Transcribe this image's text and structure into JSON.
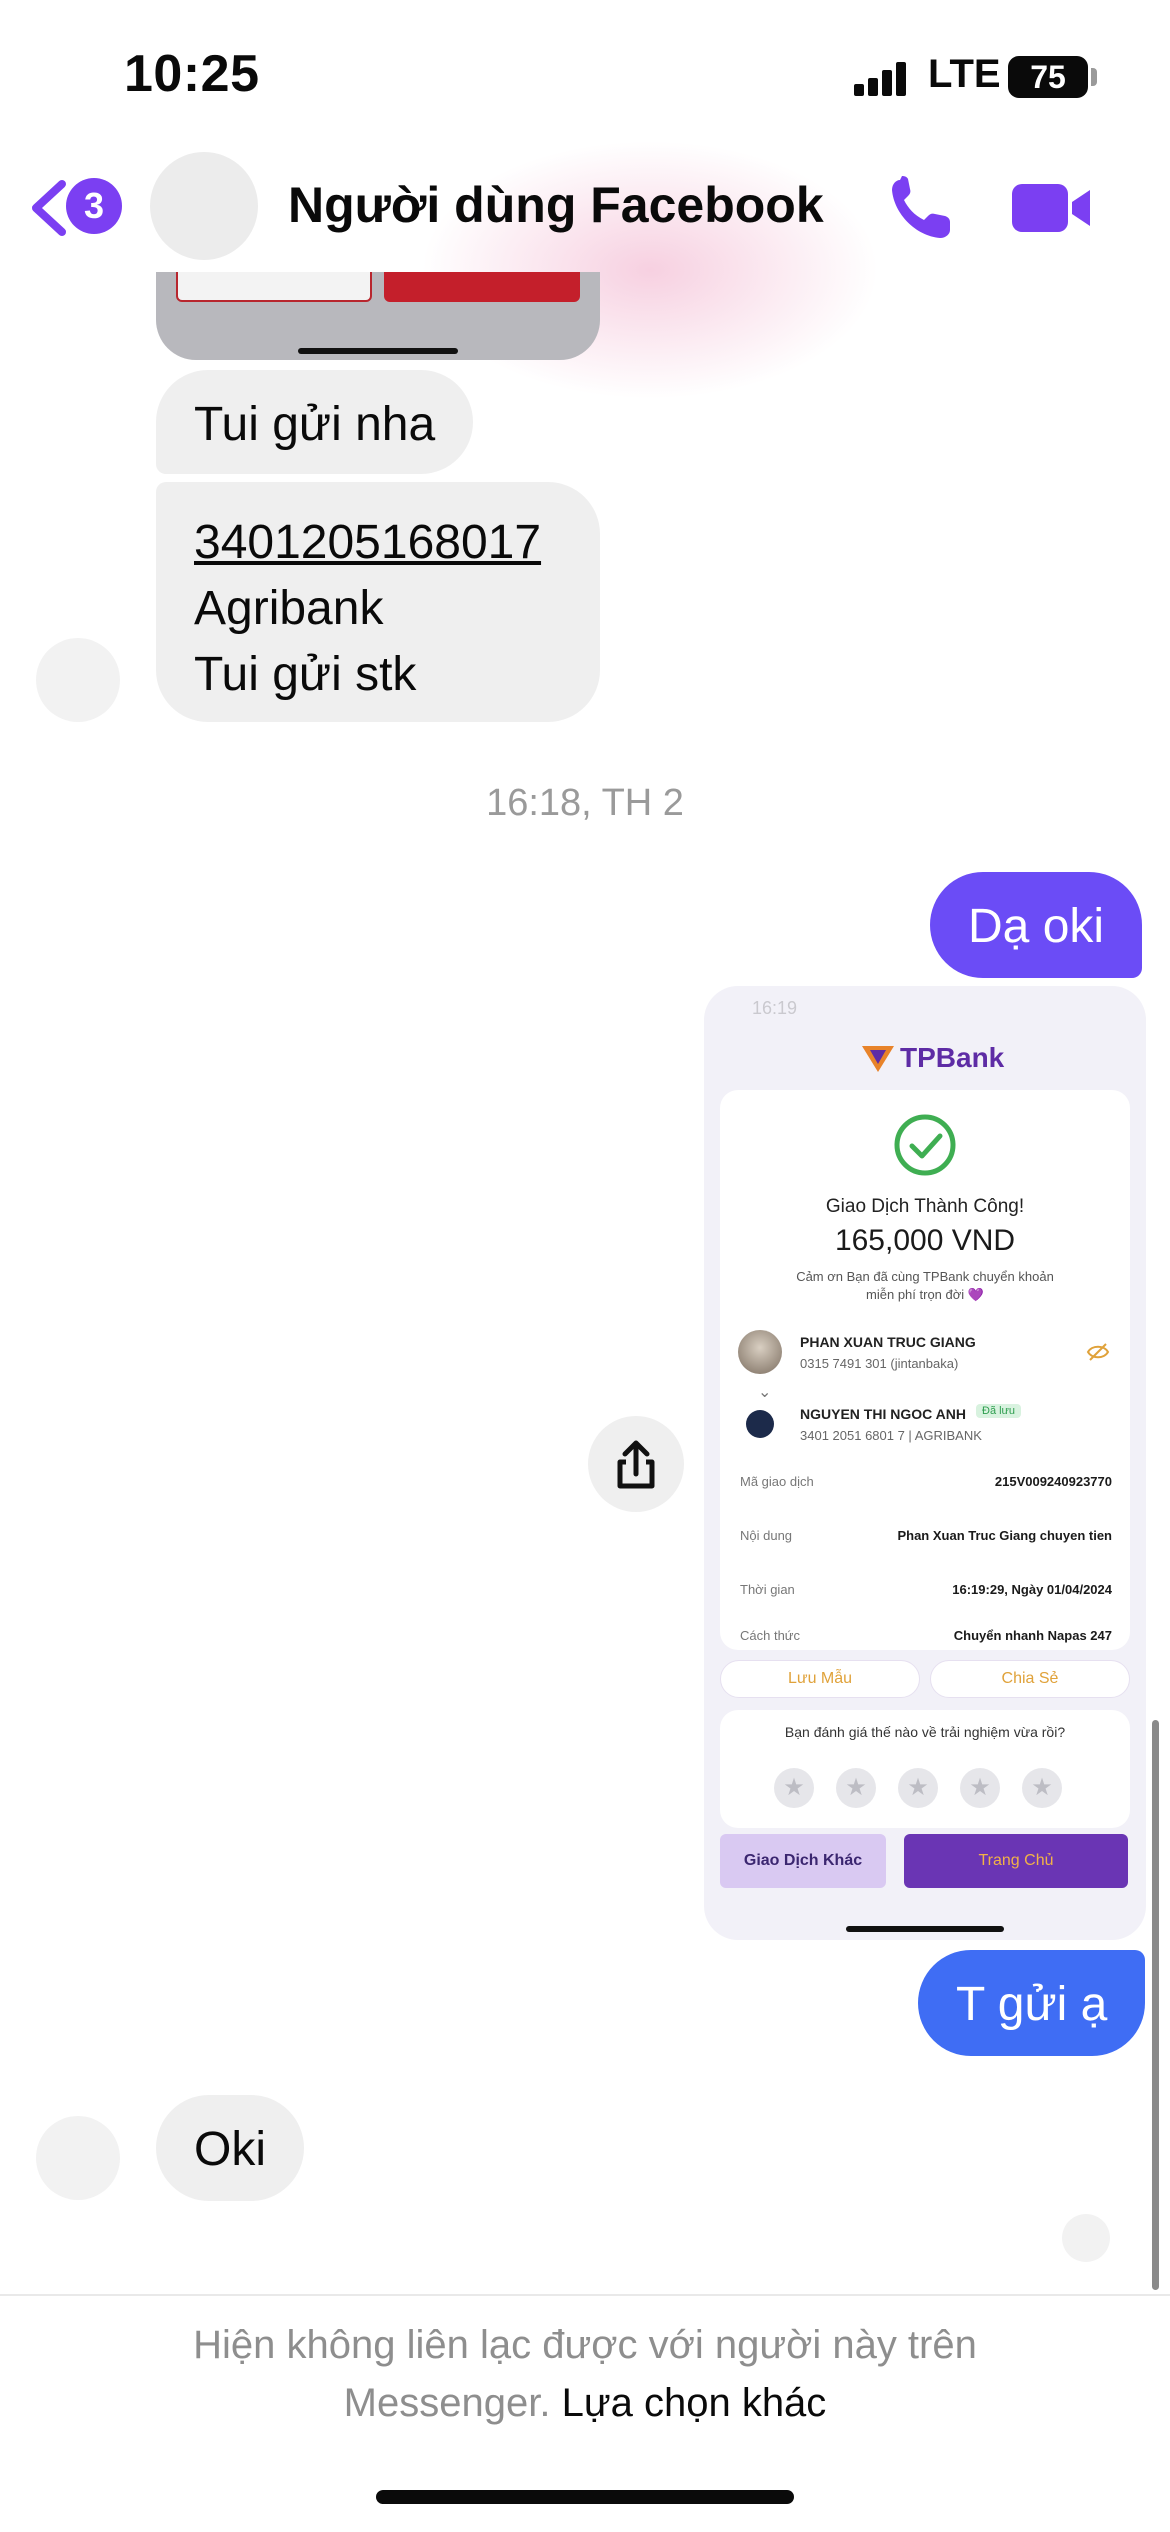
{
  "status_bar": {
    "time": "10:25",
    "network": "LTE",
    "battery": "75"
  },
  "header": {
    "back_badge_count": "3",
    "title": "Người dùng Facebook"
  },
  "messages": {
    "incoming_1": "Tui gửi nha",
    "incoming_2_lines": [
      "3401205168017",
      "Agribank",
      "Tui gửi stk"
    ],
    "timestamp": "16:18, TH 2",
    "outgoing_1": "Dạ oki",
    "outgoing_2": "T gửi ạ",
    "incoming_3": "Oki"
  },
  "receipt": {
    "status_time": "16:19",
    "bank_logo": "TPBank",
    "title": "Giao Dịch Thành Công!",
    "amount": "165,000 VND",
    "thanks_line1": "Cảm ơn Bạn đã cùng TPBank chuyển khoản",
    "thanks_line2": "miễn phí trọn đời 💜",
    "sender_name": "PHAN XUAN TRUC GIANG",
    "sender_account": "0315 7491 301 (jintanbaka)",
    "receiver_name": "NGUYEN THI NGOC ANH",
    "receiver_saved": "Đã lưu",
    "receiver_account": "3401 2051 6801 7 | AGRIBANK",
    "rows": [
      {
        "label": "Mã giao dịch",
        "value": "215V009240923770"
      },
      {
        "label": "Nội dung",
        "value": "Phan Xuan Truc Giang chuyen tien"
      },
      {
        "label": "Thời gian",
        "value": "16:19:29, Ngày 01/04/2024"
      },
      {
        "label": "Cách thức",
        "value": "Chuyển nhanh Napas 247"
      }
    ],
    "save_template": "Lưu Mẫu",
    "share": "Chia Sẻ",
    "rating_question": "Bạn đánh giá thế nào về trải nghiệm vừa rồi?",
    "other_transaction": "Giao Dịch Khác",
    "home": "Trang Chủ"
  },
  "footer": {
    "note_line1": "Hiện không liên lạc được với người này trên",
    "note_line2": "Messenger.",
    "link": "Lựa chọn khác"
  },
  "colors": {
    "accent_purple": "#7b3ff2",
    "outgoing_bubble_1": "#6b4cf6",
    "outgoing_bubble_2": "#3f6df4",
    "incoming_bubble": "#efefef"
  },
  "icons": [
    "back-chevron-icon",
    "phone-icon",
    "video-camera-icon",
    "share-icon",
    "check-circle-icon",
    "eye-off-icon",
    "star-icon"
  ]
}
